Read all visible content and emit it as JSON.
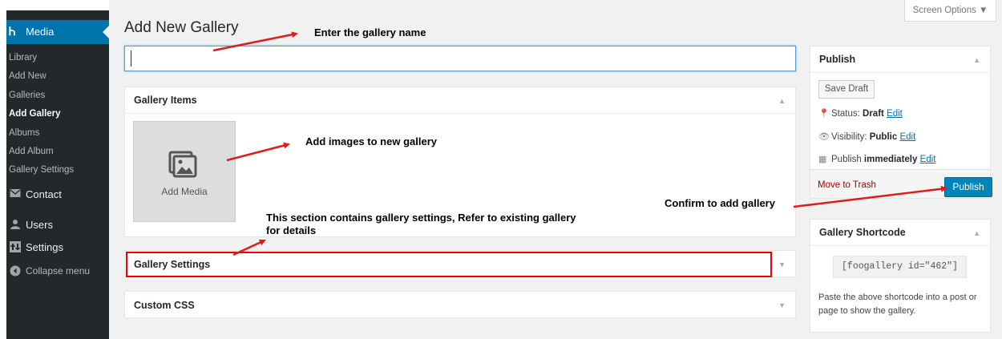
{
  "sidebar": {
    "media_icon": "Ꮒ",
    "media_label": "Media",
    "submenu": [
      {
        "label": "Library",
        "current": false
      },
      {
        "label": "Add New",
        "current": false
      },
      {
        "label": "Galleries",
        "current": false
      },
      {
        "label": "Add Gallery",
        "current": true
      },
      {
        "label": "Albums",
        "current": false
      },
      {
        "label": "Add Album",
        "current": false
      },
      {
        "label": "Gallery Settings",
        "current": false
      }
    ],
    "contact_label": "Contact",
    "users_label": "Users",
    "settings_label": "Settings",
    "collapse_label": "Collapse menu",
    "icons": {
      "contact": "envelope-icon",
      "users": "users-icon",
      "settings": "settings-icon",
      "collapse": "collapse-icon"
    }
  },
  "header": {
    "screen_options": "Screen Options ▼",
    "page_title": "Add New Gallery"
  },
  "title_field": {
    "value": "",
    "placeholder": ""
  },
  "gallery_items": {
    "heading": "Gallery Items",
    "add_media_label": "Add Media"
  },
  "gallery_settings": {
    "heading": "Gallery Settings"
  },
  "custom_css": {
    "heading": "Custom CSS"
  },
  "publish": {
    "heading": "Publish",
    "save_draft": "Save Draft",
    "status_label": "Status:",
    "status_value": "Draft",
    "visibility_label": "Visibility:",
    "visibility_value": "Public",
    "publish_label": "Publish",
    "publish_value": "immediately",
    "edit_link": "Edit",
    "move_to_trash": "Move to Trash",
    "publish_button": "Publish"
  },
  "shortcode": {
    "heading": "Gallery Shortcode",
    "code": "[foogallery id=\"462\"]",
    "help": "Paste the above shortcode into a post or page to show the gallery."
  },
  "annotations": {
    "name": "Enter the gallery name",
    "images": "Add images to new gallery",
    "confirm": "Confirm to add gallery",
    "settings_line1": "This section contains gallery settings, Refer to existing gallery",
    "settings_line2": "for details"
  },
  "colors": {
    "sidebar_bg": "#23282d",
    "accent": "#0073aa",
    "publish_button": "#0085ba",
    "annotation_arrow": "#e01b1b",
    "highlight_border": "#ee0000"
  }
}
